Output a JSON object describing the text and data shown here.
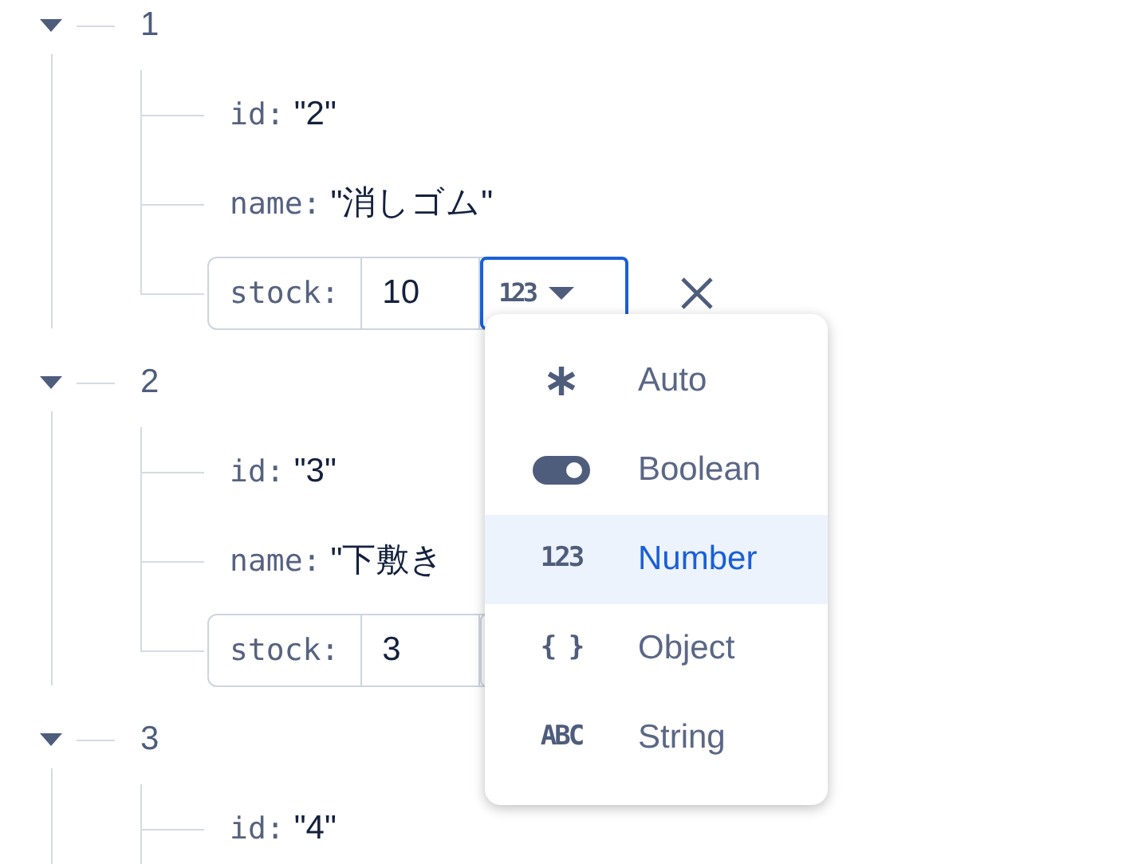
{
  "items": [
    {
      "index": "1",
      "expanded": true,
      "fields": [
        {
          "kind": "text",
          "key": "id:",
          "value": "\"2\""
        },
        {
          "kind": "text",
          "key": "name:",
          "value": "\"消しゴム\""
        },
        {
          "kind": "edit",
          "key": "stock:",
          "value": "10",
          "type_glyph": "123",
          "focused": true
        }
      ]
    },
    {
      "index": "2",
      "expanded": true,
      "fields": [
        {
          "kind": "text",
          "key": "id:",
          "value": "\"3\""
        },
        {
          "kind": "text",
          "key": "name:",
          "value": "\"下敷き"
        },
        {
          "kind": "edit",
          "key": "stock:",
          "value": "3",
          "focused": false
        }
      ]
    },
    {
      "index": "3",
      "expanded": true,
      "fields": [
        {
          "kind": "text",
          "key": "id:",
          "value": "\"4\""
        }
      ]
    }
  ],
  "type_menu": {
    "items": [
      {
        "kind": "asterisk",
        "label": "Auto",
        "selected": false
      },
      {
        "kind": "toggle",
        "label": "Boolean",
        "selected": false
      },
      {
        "kind": "glyph",
        "glyph": "123",
        "label": "Number",
        "selected": true
      },
      {
        "kind": "glyph",
        "glyph": "{ }",
        "label": "Object",
        "selected": false
      },
      {
        "kind": "glyph",
        "glyph": "ABC",
        "label": "String",
        "selected": false
      }
    ]
  }
}
